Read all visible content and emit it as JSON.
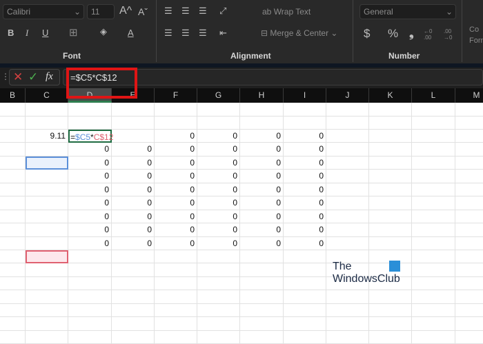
{
  "ribbon": {
    "font_name": "Calibri",
    "font_size": "11",
    "bold": "B",
    "italic": "I",
    "underline": "U",
    "font_group": "Font",
    "alignment_group": "Alignment",
    "number_group": "Number",
    "wrap_text": "Wrap Text",
    "merge_center": "Merge & Center",
    "number_format": "General",
    "currency": "$",
    "percent": "%",
    "comma": "❟",
    "increase_decimal": "←0 .00",
    "decrease_decimal": ".00 →0",
    "conditional_format": "Co Form"
  },
  "formula_bar": {
    "fx": "fx",
    "value": "=$C5*C$12"
  },
  "columns": [
    "B",
    "C",
    "D",
    "E",
    "F",
    "G",
    "H",
    "I",
    "J",
    "K",
    "L",
    "M"
  ],
  "active_cell": {
    "prefix": "=",
    "ref1": "$C5",
    "op": "*",
    "ref2": "C$12"
  },
  "c5_value": "9.11",
  "row5": {
    "F": "0",
    "G": "0",
    "H": "0",
    "I": "0"
  },
  "zero_rows": [
    [
      "0",
      "0",
      "0",
      "0",
      "0",
      "0"
    ],
    [
      "0",
      "0",
      "0",
      "0",
      "0",
      "0"
    ],
    [
      "0",
      "0",
      "0",
      "0",
      "0",
      "0"
    ],
    [
      "0",
      "0",
      "0",
      "0",
      "0",
      "0"
    ],
    [
      "0",
      "0",
      "0",
      "0",
      "0",
      "0"
    ],
    [
      "0",
      "0",
      "0",
      "0",
      "0",
      "0"
    ],
    [
      "0",
      "0",
      "0",
      "0",
      "0",
      "0"
    ],
    [
      "0",
      "0",
      "0",
      "0",
      "0",
      "0"
    ]
  ],
  "watermark": {
    "line1": "The",
    "line2": "WindowsClub"
  },
  "colors": {
    "ref_blue": "#5b8fd9",
    "ref_red": "#e06070",
    "highlight": "#e01515"
  }
}
